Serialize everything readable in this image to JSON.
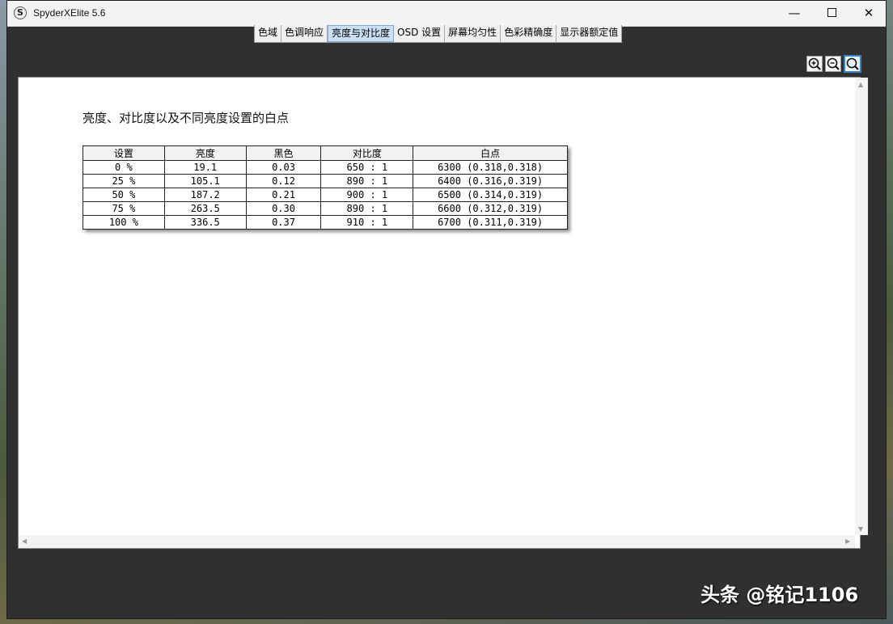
{
  "window": {
    "title": "SpyderXElite 5.6"
  },
  "window_controls": {
    "minimize": "—",
    "close": "✕"
  },
  "tabs": [
    {
      "label": "色域",
      "active": false
    },
    {
      "label": "色调响应",
      "active": false
    },
    {
      "label": "亮度与对比度",
      "active": true
    },
    {
      "label": "OSD 设置",
      "active": false
    },
    {
      "label": "屏幕均匀性",
      "active": false
    },
    {
      "label": "色彩精确度",
      "active": false
    },
    {
      "label": "显示器额定值",
      "active": false
    }
  ],
  "toolbar": {
    "zoom_in_icon": "zoom-in-icon",
    "zoom_out_icon": "zoom-out-icon",
    "zoom_fit_icon": "zoom-fit-icon"
  },
  "report": {
    "title": "亮度、对比度以及不同亮度设置的白点",
    "columns": [
      "设置",
      "亮度",
      "黑色",
      "对比度",
      "白点"
    ],
    "rows": [
      [
        "0 %",
        "19.1",
        "0.03",
        "650 : 1",
        "6300 (0.318,0.318)"
      ],
      [
        "25 %",
        "105.1",
        "0.12",
        "890 : 1",
        "6400 (0.316,0.319)"
      ],
      [
        "50 %",
        "187.2",
        "0.21",
        "900 : 1",
        "6500 (0.314,0.319)"
      ],
      [
        "75 %",
        "263.5",
        "0.30",
        "890 : 1",
        "6600 (0.312,0.319)"
      ],
      [
        "100 %",
        "336.5",
        "0.37",
        "910 : 1",
        "6700 (0.311,0.319)"
      ]
    ]
  },
  "watermark": "头条 @铭记1106",
  "colors": {
    "window_bg": "#303030",
    "active_tab": "#cce0f5",
    "accent": "#3b82c4"
  }
}
